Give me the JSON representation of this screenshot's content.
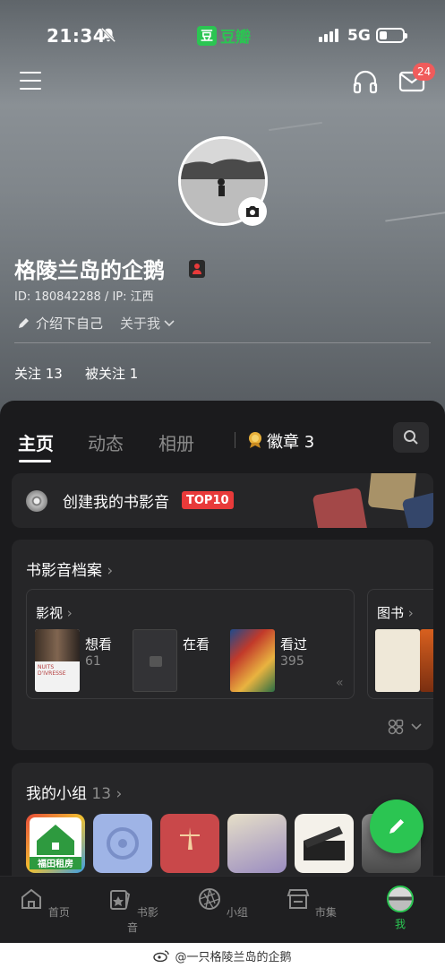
{
  "status_bar": {
    "time": "21:34",
    "app_name": "豆瓣",
    "app_logo_char": "豆",
    "network": "5G"
  },
  "header": {
    "mail_badge": "24"
  },
  "profile": {
    "username": "格陵兰岛的企鹅",
    "id_line": "ID: 180842288 / IP: 江西",
    "intro": "介绍下自己",
    "about": "关于我",
    "following": "关注 13",
    "followers": "被关注 1"
  },
  "tabs": {
    "home": "主页",
    "activity": "动态",
    "album": "相册",
    "badges": "徽章 3"
  },
  "create_card": {
    "title": "创建我的书影音",
    "tag": "TOP10"
  },
  "archive": {
    "title": "书影音档案",
    "movies": {
      "title": "影视",
      "wish_label": "想看",
      "wish_count": "61",
      "watching_label": "在看",
      "watched_label": "看过",
      "watched_count": "395"
    },
    "books": {
      "title": "图书"
    }
  },
  "groups": {
    "title": "我的小组",
    "count": "13",
    "first_group_label": "福田租房"
  },
  "bottom_nav": {
    "home": "首页",
    "media": "书影音",
    "group": "小组",
    "market": "市集",
    "me": "我"
  },
  "watermark": "@一只格陵兰岛的企鹅",
  "colors": {
    "accent": "#2bc552",
    "badge_red": "#f05b5b",
    "panel_bg": "#1b1b1d",
    "card_bg": "#262628"
  }
}
